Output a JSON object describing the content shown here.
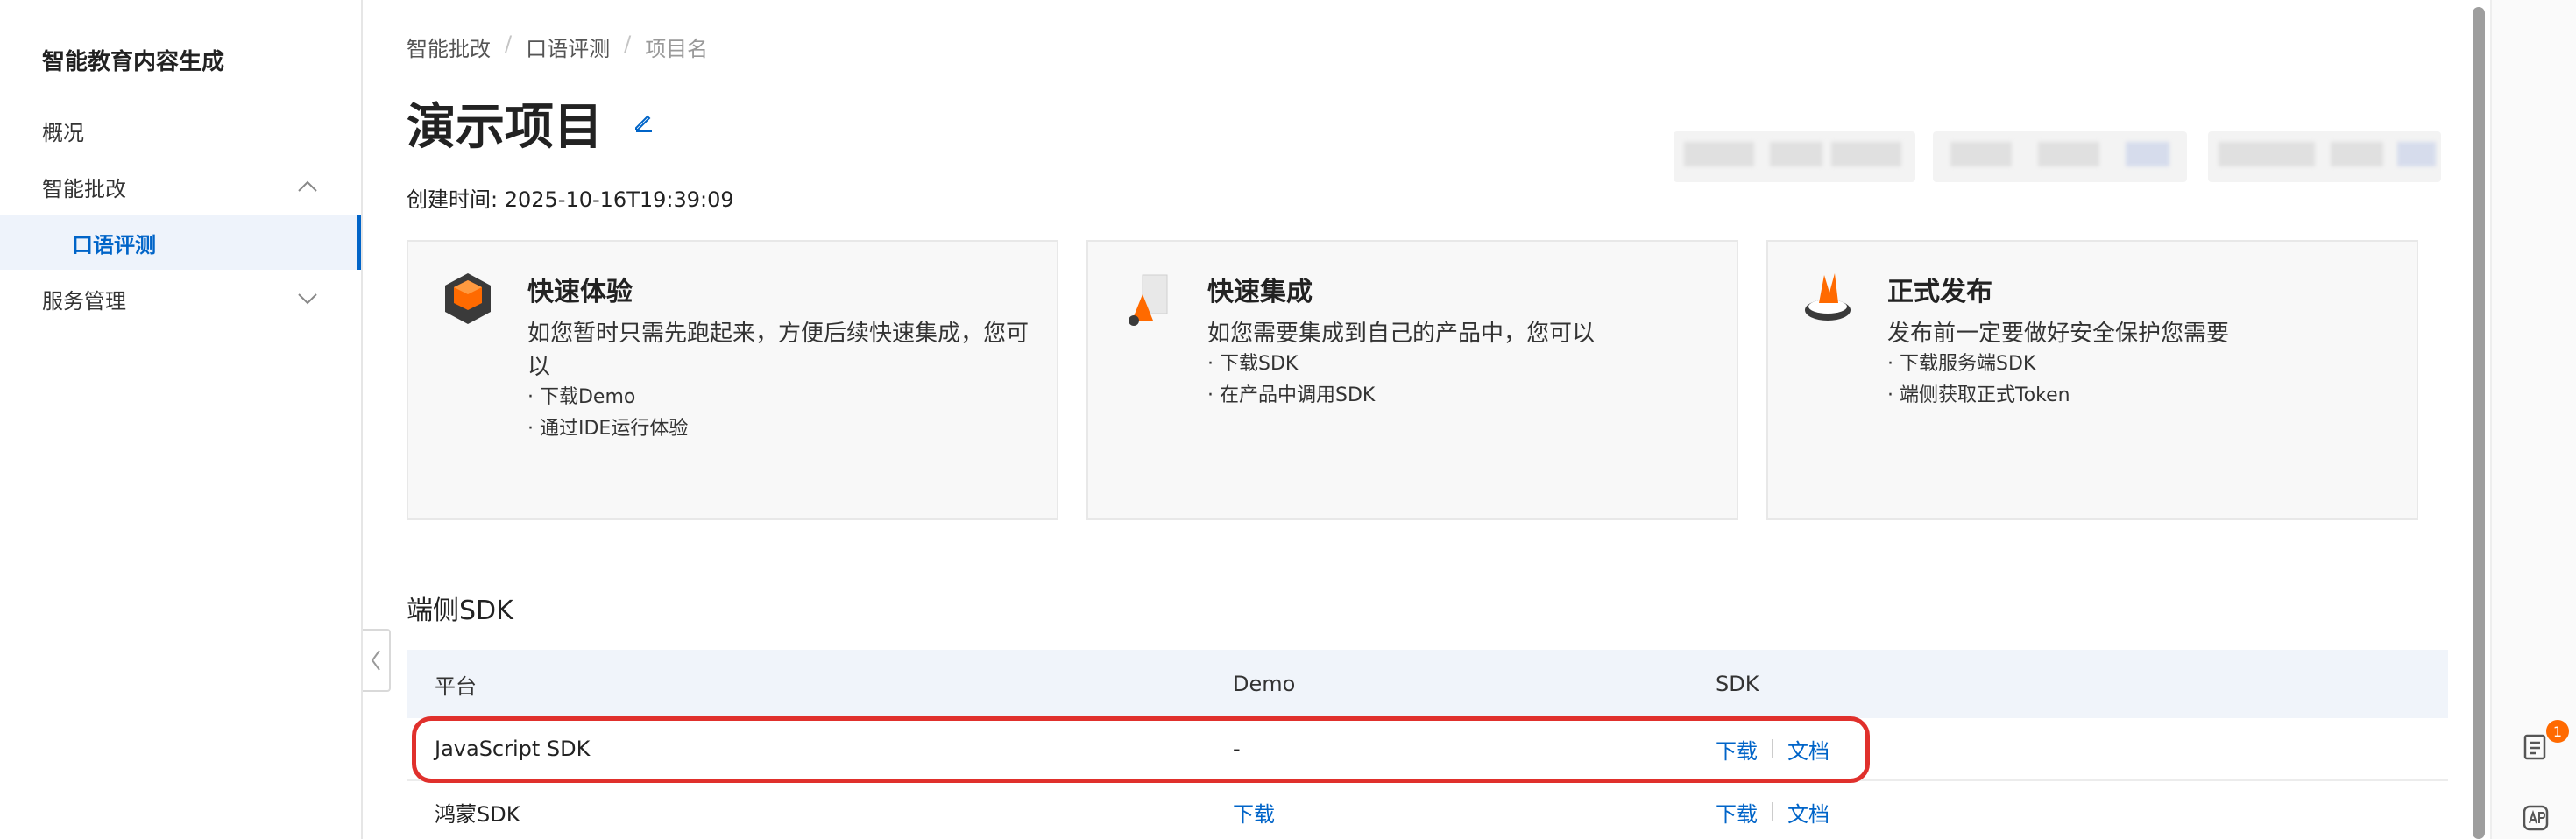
{
  "sidebar": {
    "title": "智能教育内容生成",
    "items": [
      {
        "label": "概况"
      },
      {
        "label": "智能批改"
      },
      {
        "label": "口语评测"
      },
      {
        "label": "服务管理"
      }
    ]
  },
  "breadcrumb": {
    "items": [
      "智能批改",
      "口语评测",
      "项目名"
    ]
  },
  "page": {
    "title": "演示项目",
    "created": "创建时间: 2025-10-16T19:39:09"
  },
  "cards": [
    {
      "title": "快速体验",
      "desc": "如您暂时只需先跑起来，方便后续快速集成，您可以",
      "items": [
        "· 下载Demo",
        "· 通过IDE运行体验"
      ]
    },
    {
      "title": "快速集成",
      "desc": "如您需要集成到自己的产品中，您可以",
      "items": [
        "· 下载SDK",
        "· 在产品中调用SDK"
      ]
    },
    {
      "title": "正式发布",
      "desc": "发布前一定要做好安全保护您需要",
      "items": [
        "· 下载服务端SDK",
        "· 端侧获取正式Token"
      ]
    }
  ],
  "sdk_section": {
    "title": "端侧SDK",
    "columns": [
      "平台",
      "Demo",
      "SDK"
    ],
    "rows": [
      {
        "platform": "JavaScript SDK",
        "demo": "-",
        "sdk_download": "下载",
        "sdk_docs": "文档"
      },
      {
        "platform": "鸿蒙SDK",
        "demo": "下载",
        "sdk_download": "下载",
        "sdk_docs": "文档"
      }
    ]
  },
  "right_rail": {
    "badge_count": "1"
  },
  "colors": {
    "accent": "#0064c8",
    "highlight": "#e0302c",
    "badge": "#ff6a00"
  }
}
